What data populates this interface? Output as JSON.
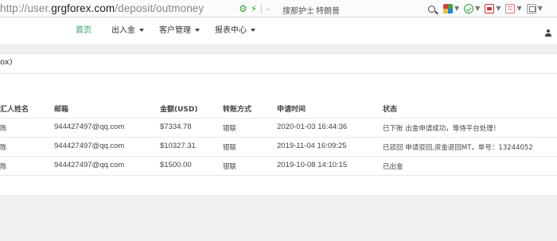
{
  "browser": {
    "url_prefix": "http://user.",
    "url_host": "grgforex.com",
    "url_path": "/deposit/outmoney",
    "suggestions": [
      "搜那护士",
      "特朗普"
    ],
    "icon_names": [
      "gear-icon",
      "lightning-icon",
      "search-icon",
      "apps-extension-icon",
      "shield-extension-icon",
      "pdf-extension-icon",
      "cut-extension-icon",
      "screenshot-extension-icon"
    ]
  },
  "nav": {
    "items": [
      {
        "label": "首页",
        "active": true
      },
      {
        "label": "出入金",
        "dropdown": true
      },
      {
        "label": "客户管理",
        "dropdown": true
      },
      {
        "label": "报表中心",
        "dropdown": true
      }
    ],
    "active_color": "#1fa861"
  },
  "breadcrumb": "ox)",
  "table": {
    "headers": [
      "汇人姓名",
      "邮箱",
      "金额(USD)",
      "转账方式",
      "申请时间",
      "状态"
    ],
    "rows": [
      {
        "name": "陈",
        "email": "944427497@qq.com",
        "amount": "$7334.78",
        "method": "银联",
        "time": "2020-01-03 16:44:36",
        "status": "已下账 出金申请成功，等待平台处理！"
      },
      {
        "name": "陈",
        "email": "944427497@qq.com",
        "amount": "$10327.31",
        "method": "银联",
        "time": "2019-11-04 16:09:25",
        "status": "已驳回 申请驳回,资金退回MT，单号：13244052"
      },
      {
        "name": "陈",
        "email": "944427497@qq.com",
        "amount": "$1500.00",
        "method": "银联",
        "time": "2019-10-08 14:10:15",
        "status": "已出金"
      }
    ]
  }
}
